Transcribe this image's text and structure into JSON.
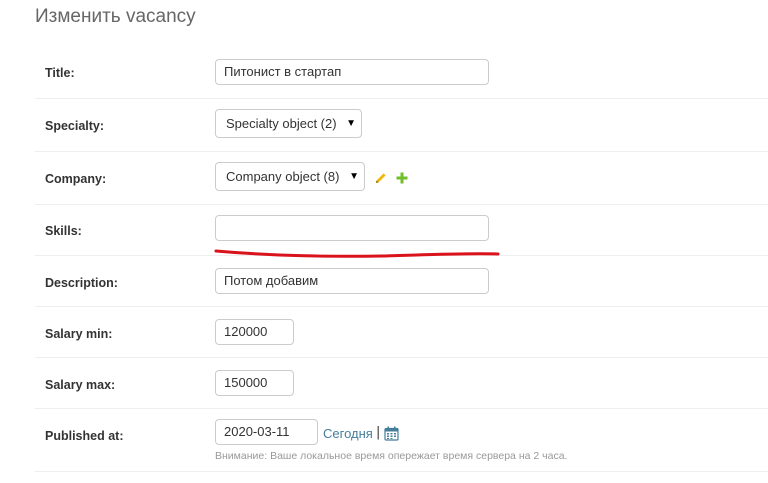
{
  "page": {
    "title": "Изменить vacancy"
  },
  "form": {
    "title": {
      "label": "Title:",
      "value": "Питонист в стартап"
    },
    "specialty": {
      "label": "Specialty:",
      "selected": "Specialty object (2)"
    },
    "company": {
      "label": "Company:",
      "selected": "Company object (8)"
    },
    "skills": {
      "label": "Skills:",
      "value": ""
    },
    "description": {
      "label": "Description:",
      "value": "Потом добавим"
    },
    "salary_min": {
      "label": "Salary min:",
      "value": "120000"
    },
    "salary_max": {
      "label": "Salary max:",
      "value": "150000"
    },
    "published_at": {
      "label": "Published at:",
      "value": "2020-03-11",
      "today_link": "Сегодня",
      "separator": "|",
      "help": "Внимание: Ваше локальное время опережает время сервера на 2 часа."
    }
  },
  "icons": {
    "edit": "pencil-icon",
    "add": "plus-icon",
    "calendar": "calendar-icon",
    "dropdown": "triangle-down-icon"
  },
  "colors": {
    "link": "#447e9b",
    "pencil": "#efb80b",
    "plus": "#70bf2b",
    "annotation": "#d9121b"
  }
}
